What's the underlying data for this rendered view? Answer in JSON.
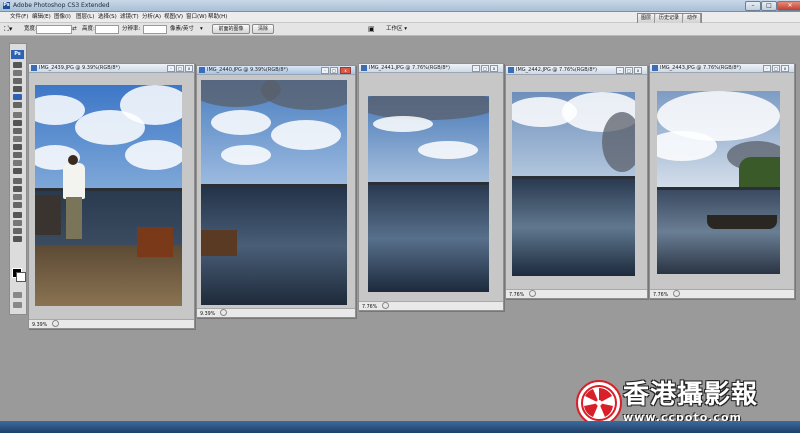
{
  "app": {
    "title": "Adobe Photoshop CS3 Extended",
    "icon_label": "Ps",
    "window_controls": [
      "minimize-icon",
      "maximize-icon",
      "close-icon"
    ]
  },
  "menu": {
    "items": [
      "文件(F)",
      "编辑(E)",
      "图像(I)",
      "图层(L)",
      "选择(S)",
      "滤镜(T)",
      "分析(A)",
      "视图(V)",
      "窗口(W)",
      "帮助(H)"
    ]
  },
  "panel_tabs": [
    "图层",
    "历史记录",
    "动作"
  ],
  "options_bar": {
    "width_label": "宽度:",
    "height_label": "高度:",
    "resolution_label": "分辨率:",
    "resolution_unit": "像素/英寸",
    "front_image_button": "前面的图像",
    "clear_button": "清除",
    "workspace_label": "工作区 ▾"
  },
  "toolbox": {
    "logo": "Ps"
  },
  "documents": [
    {
      "title": "IMG_2439.JPG @ 9.39%(RGB/8*)",
      "zoom": "9.39%",
      "active": false
    },
    {
      "title": "IMG_2440.JPG @ 9.39%(RGB/8*)",
      "zoom": "9.39%",
      "active": true
    },
    {
      "title": "IMG_2441.JPG @ 7.76%(RGB/8*)",
      "zoom": "7.76%",
      "active": false
    },
    {
      "title": "IMG_2442.JPG @ 7.76%(RGB/8*)",
      "zoom": "7.76%",
      "active": false
    },
    {
      "title": "IMG_2443.JPG @ 7.76%(RGB/8*)",
      "zoom": "7.76%",
      "active": false
    }
  ],
  "watermark": {
    "title": "香港攝影報",
    "url": "www.ccpoto.com"
  },
  "colors": {
    "workspace_bg": "#9a9a9a",
    "titlebar": "#b9cbe0",
    "close_button": "#c0402c",
    "watermark_red": "#d7202a"
  }
}
